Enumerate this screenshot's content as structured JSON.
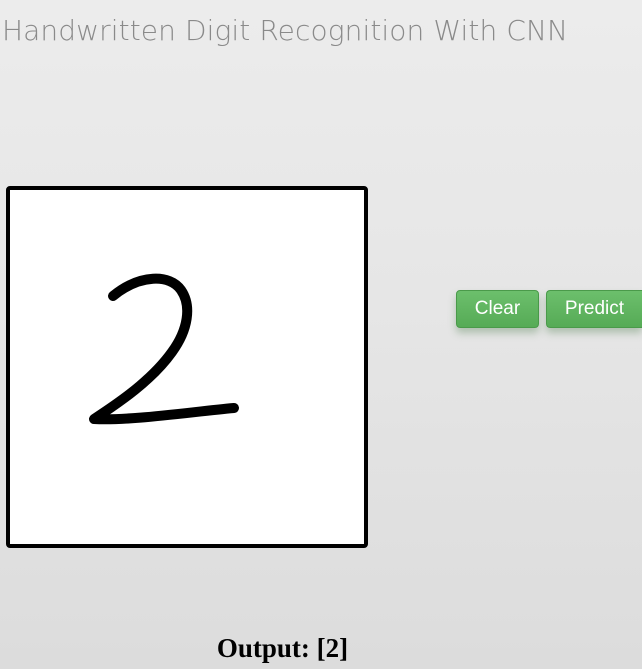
{
  "header": {
    "title": "Handwritten Digit Recognition With CNN"
  },
  "canvas": {
    "drawn_digit": "2",
    "stroke_color": "#000000",
    "background_color": "#ffffff",
    "border_color": "#000000"
  },
  "actions": {
    "clear_label": "Clear",
    "predict_label": "Predict",
    "button_color": "#5cb85c"
  },
  "result": {
    "label": "Output:",
    "value": "[2]"
  }
}
